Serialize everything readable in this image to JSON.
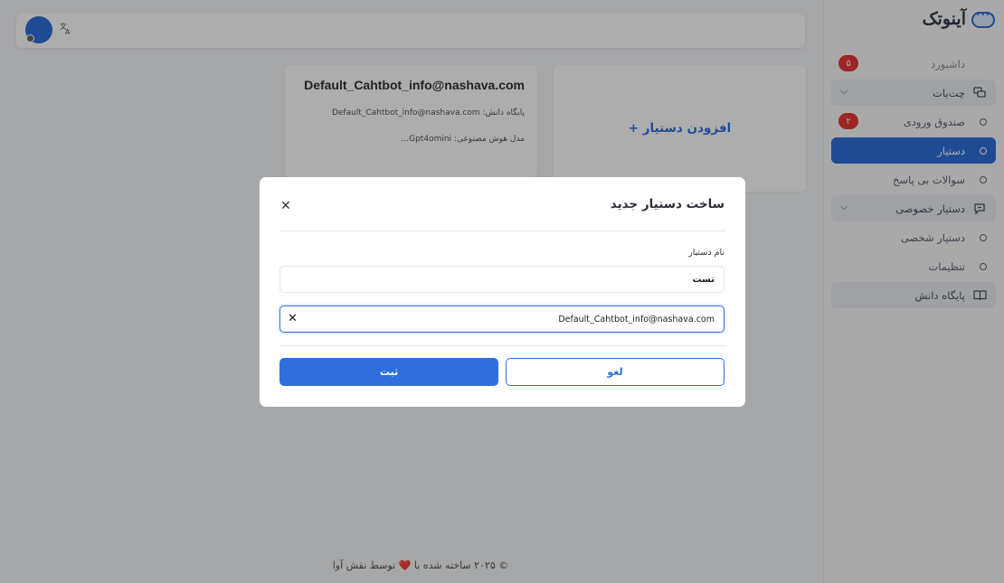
{
  "sidebar": {
    "logo_text": "آینوتک",
    "items": [
      {
        "label": "داشبورد",
        "badge": "۵"
      },
      {
        "label": "چت‌بات"
      },
      {
        "label": "صندوق ورودی",
        "badge": "۲"
      },
      {
        "label": "دستیار"
      },
      {
        "label": "سوالات بی پاسخ"
      },
      {
        "label": "دستیار خصوصی"
      },
      {
        "label": "دستیار شخصی"
      },
      {
        "label": "تنظیمات"
      },
      {
        "label": "پایگاه دانش"
      }
    ]
  },
  "bot_card": {
    "title": "Default_Cahtbot_info@nashava.com",
    "kb_line": "پایگاه دانش: Default_Cahtbot_info@nashava.com",
    "model_line": "مدل هوش مصنوعی: Gpt4omini..."
  },
  "add_card": {
    "label": "افزودن دستیار +"
  },
  "footer": {
    "before": "© ۲۰۲۵ ساخته شده با",
    "heart": "❤️",
    "after": "توسط نقش آوا"
  },
  "modal": {
    "title": "ساخت دستیار جدید",
    "name_label": "نام دستیار",
    "name_value": "تست",
    "kb_value": "Default_Cahtbot_info@nashava.com",
    "cancel_label": "لغو",
    "submit_label": "ثبت"
  },
  "colors": {
    "primary": "#2f6fdb",
    "badge": "#e53935",
    "overlay": "rgba(0,0,0,0.32)"
  }
}
